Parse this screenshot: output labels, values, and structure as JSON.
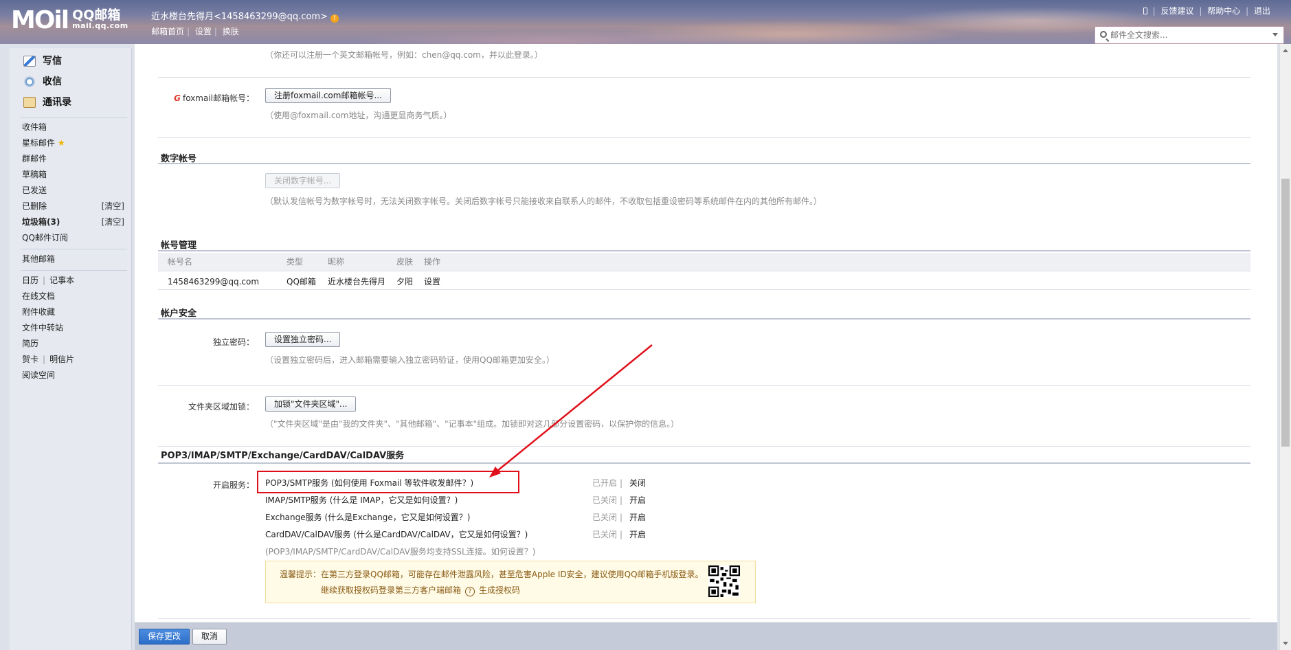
{
  "header": {
    "logo_mark": "MOil",
    "logo_name": "QQ邮箱",
    "logo_domain": "mail.qq.com",
    "user_display": "近水楼台先得月<1458463299@qq.com>",
    "warn_icon": "!",
    "nav": [
      "邮箱首页",
      "设置",
      "换肤"
    ],
    "nav_sep": "|",
    "top_links": [
      "反馈建议",
      "帮助中心",
      "退出"
    ],
    "search_placeholder": "邮件全文搜索..."
  },
  "sidebar": {
    "compose": "写信",
    "inbox_big": "收信",
    "contacts": "通讯录",
    "folders": [
      {
        "label": "收件箱"
      },
      {
        "label": "星标邮件",
        "star": "★"
      },
      {
        "label": "群邮件"
      },
      {
        "label": "草稿箱"
      },
      {
        "label": "已发送"
      },
      {
        "label": "已删除",
        "right": "[清空]"
      },
      {
        "label": "垃圾箱(3)",
        "right": "[清空]"
      },
      {
        "label": "QQ邮件订阅"
      }
    ],
    "other_mailbox": "其他邮箱",
    "tools": {
      "calendar": "日历",
      "notes": "记事本",
      "docs": "在线文档",
      "attachments": "附件收藏",
      "transfer": "文件中转站",
      "resume": "简历",
      "card": "贺卡",
      "postcard": "明信片",
      "reading": "阅读空间",
      "sep": "|"
    }
  },
  "content": {
    "english_hint": "（你还可以注册一个英文邮箱帐号，例如：chen@qq.com，并以此登录。）",
    "foxmail_label": "foxmail邮箱帐号：",
    "foxmail_button": "注册foxmail.com邮箱帐号...",
    "foxmail_hint": "（使用@foxmail.com地址，沟通更显商务气质。）",
    "numeric_title": "数字帐号",
    "numeric_button": "关闭数字帐号...",
    "numeric_hint": "（默认发信帐号为数字帐号时，无法关闭数字帐号。关闭后数字帐号只能接收来自联系人的邮件，不收取包括重设密码等系统邮件在内的其他所有邮件。）",
    "accounts_title": "帐号管理",
    "accounts_columns": [
      "帐号名",
      "类型",
      "昵称",
      "皮肤",
      "操作"
    ],
    "accounts_rows": [
      {
        "account": "1458463299@qq.com",
        "type": "QQ邮箱",
        "nickname": "近水楼台先得月",
        "skin": "夕阳",
        "action": "设置"
      }
    ],
    "security_title": "帐户安全",
    "password_label": "独立密码：",
    "password_button": "设置独立密码...",
    "password_hint": "（设置独立密码后，进入邮箱需要输入独立密码验证，使用QQ邮箱更加安全。）",
    "lock_label": "文件夹区域加锁：",
    "lock_button": "加锁\"文件夹区域\"...",
    "lock_hint": "（\"文件夹区域\"是由\"我的文件夹\"、\"其他邮箱\"、\"记事本\"组成。加锁即对这几部分设置密码，以保护你的信息。）",
    "services_title": "POP3/IMAP/SMTP/Exchange/CardDAV/CalDAV服务",
    "services_label": "开启服务：",
    "services": [
      {
        "name": "POP3/SMTP服务 (如何使用 Foxmail 等软件收发邮件？)",
        "status": "已开启",
        "action": "关闭"
      },
      {
        "name": "IMAP/SMTP服务 (什么是 IMAP，它又是如何设置？)",
        "status": "已关闭",
        "action": "开启"
      },
      {
        "name": "Exchange服务 (什么是Exchange，它又是如何设置？)",
        "status": "已关闭",
        "action": "开启"
      },
      {
        "name": "CardDAV/CalDAV服务 (什么是CardDAV/CalDAV，它又是如何设置？)",
        "status": "已关闭",
        "action": "开启"
      }
    ],
    "status_sep": "|",
    "ssl_hint": "(POP3/IMAP/SMTP/CardDAV/CalDAV服务均支持SSL连接。如何设置？)",
    "tip_line1": "温馨提示：在第三方登录QQ邮箱，可能存在邮件泄露风险，甚至危害Apple ID安全，建议使用QQ邮箱手机版登录。",
    "tip_line2a": "继续获取授权码登录第三方客户端邮箱",
    "tip_q": "?",
    "tip_line2b": "生成授权码"
  },
  "footer": {
    "save": "保存更改",
    "cancel": "取消"
  },
  "colors": {
    "annotation_red": "#e0101a",
    "save_blue": "#2d6ec8"
  }
}
